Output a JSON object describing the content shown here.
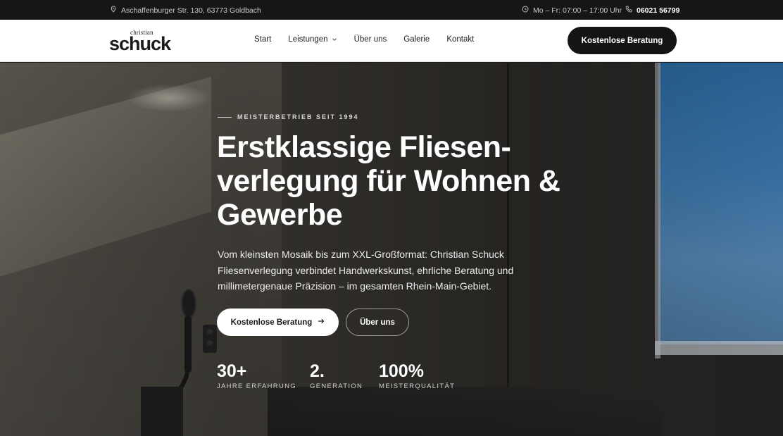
{
  "topbar": {
    "address": "Aschaffenburger Str. 130, 63773 Goldbach",
    "hours": "Mo – Fr: 07:00 – 17:00 Uhr",
    "phone": "06021 56799"
  },
  "logo": {
    "small": "christian",
    "big": "schuck"
  },
  "nav": {
    "items": [
      {
        "label": "Start"
      },
      {
        "label": "Leistungen"
      },
      {
        "label": "Über uns"
      },
      {
        "label": "Galerie"
      },
      {
        "label": "Kontakt"
      }
    ],
    "cta": "Kostenlose Beratung"
  },
  "hero": {
    "eyebrow": "MEISTERBETRIEB SEIT 1994",
    "title": "Erstklassige Fliesen-verlegung für Wohnen & Gewerbe",
    "lead": "Vom kleinsten Mosaik bis zum XXL-Großformat: Christian Schuck Fliesenverlegung verbindet Handwerkskunst, ehrliche Beratung und millimetergenaue Präzision – im gesamten Rhein-Main-Gebiet.",
    "primary_button": "Kostenlose Beratung",
    "secondary_button": "Über uns",
    "stats": [
      {
        "value": "30+",
        "label": "JAHRE ERFAHRUNG"
      },
      {
        "value": "2.",
        "label": "GENERATION"
      },
      {
        "value": "100%",
        "label": "MEISTERQUALITÄT"
      }
    ]
  },
  "colors": {
    "topbar_bg": "#161616",
    "nav_bg": "#ffffff",
    "cta_dark": "#141414",
    "text_light": "#ffffff"
  }
}
